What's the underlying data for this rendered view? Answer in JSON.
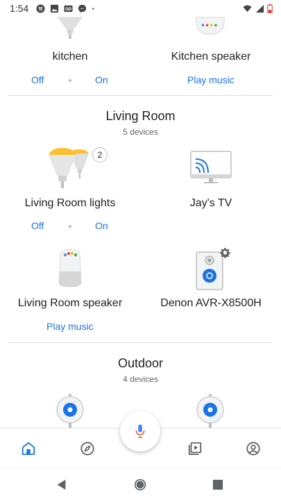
{
  "status_bar": {
    "time": "1:54",
    "icons": [
      "spotify-icon",
      "photos-icon",
      "voicemail-icon",
      "messenger-icon",
      "dot-icon"
    ],
    "right_icons": [
      "wifi-icon",
      "signal-icon",
      "battery-low-icon"
    ]
  },
  "top_row": {
    "left_tile": {
      "name": "kitchen",
      "off_label": "Off",
      "on_label": "On"
    },
    "right_tile": {
      "name": "Kitchen speaker",
      "action_label": "Play music"
    }
  },
  "living_room": {
    "title": "Living Room",
    "subtitle": "5 devices",
    "lights": {
      "name": "Living Room lights",
      "badge": "2",
      "off_label": "Off",
      "on_label": "On"
    },
    "tv": {
      "name": "Jay's TV"
    },
    "speaker": {
      "name": "Living Room speaker",
      "action_label": "Play music"
    },
    "avr": {
      "name": "Denon AVR-X8500H"
    }
  },
  "outdoor": {
    "title": "Outdoor",
    "subtitle": "4 devices"
  },
  "bottom_nav": {
    "items": [
      "home-icon",
      "explore-icon",
      "media-icon",
      "account-icon"
    ],
    "active": "home",
    "accent": "#1a73e8"
  },
  "colors": {
    "accent": "#1a73e8",
    "bulb_yellow": "#fbc02d"
  }
}
